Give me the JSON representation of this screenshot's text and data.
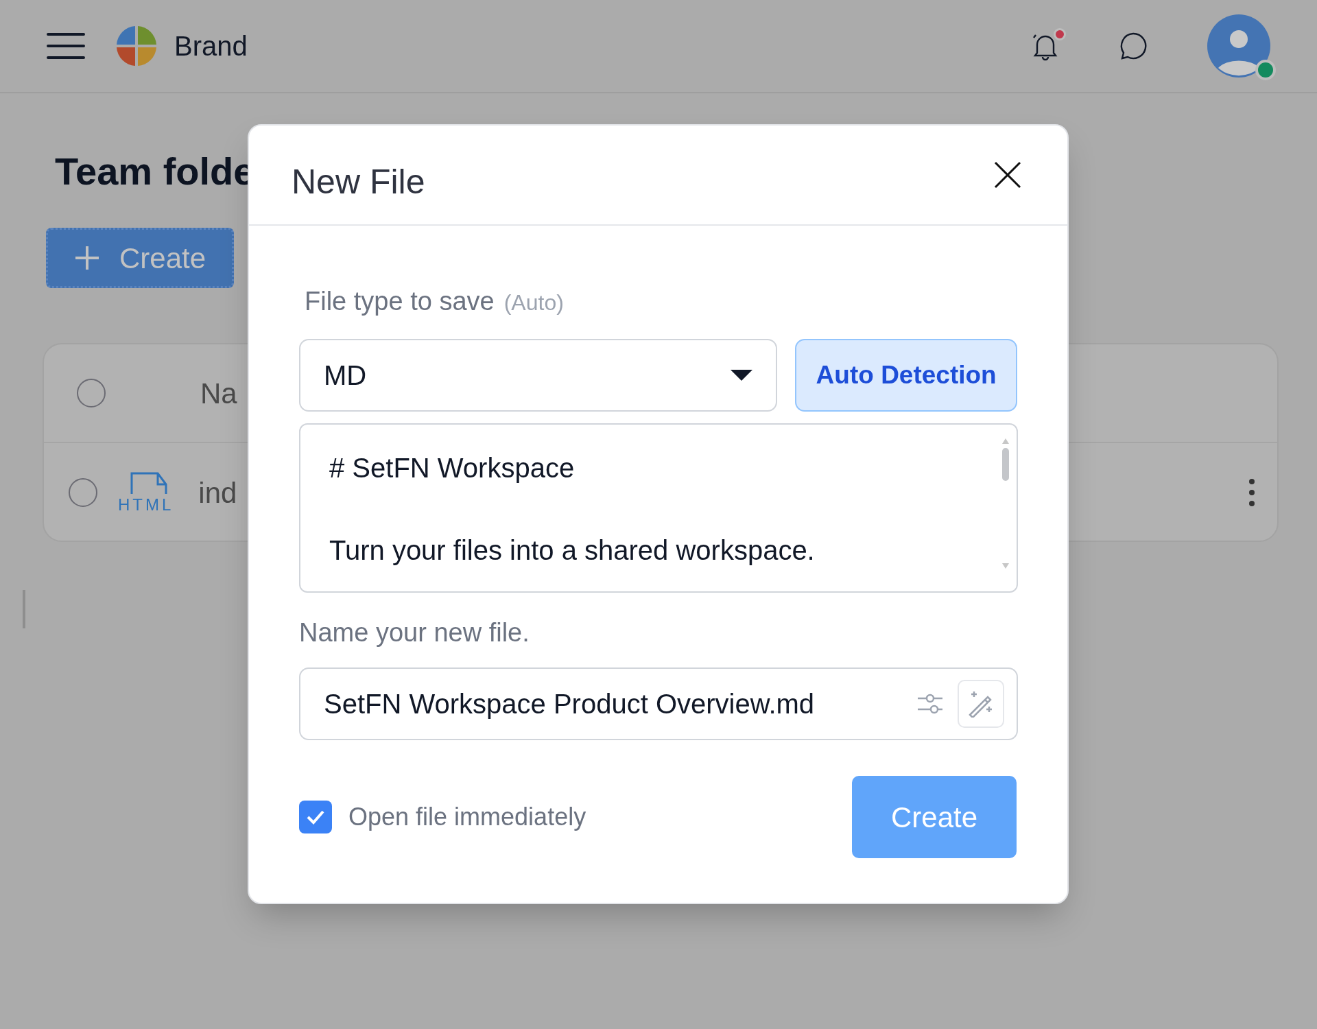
{
  "header": {
    "brand": "Brand",
    "notifications_unread": true,
    "user_online": true
  },
  "page": {
    "title": "Team folde",
    "create_button": "Create",
    "table": {
      "header": {
        "checked": false,
        "column_2": "Na"
      },
      "rows": [
        {
          "checked": false,
          "file_type": "HTML",
          "name": "ind"
        }
      ]
    }
  },
  "dialog": {
    "title": "New File",
    "file_type_label": "File type to save",
    "file_type_hint": "(Auto)",
    "file_type": "MD",
    "auto_button": "Auto Detection",
    "content": "# SetFN Workspace\n\nTurn your files into a shared workspace.",
    "name_label": "Name your new file.",
    "file_name": "SetFN Workspace Product Overview.md",
    "open_immediately": {
      "label": "Open file immediately",
      "checked": true
    },
    "submit": "Create"
  }
}
